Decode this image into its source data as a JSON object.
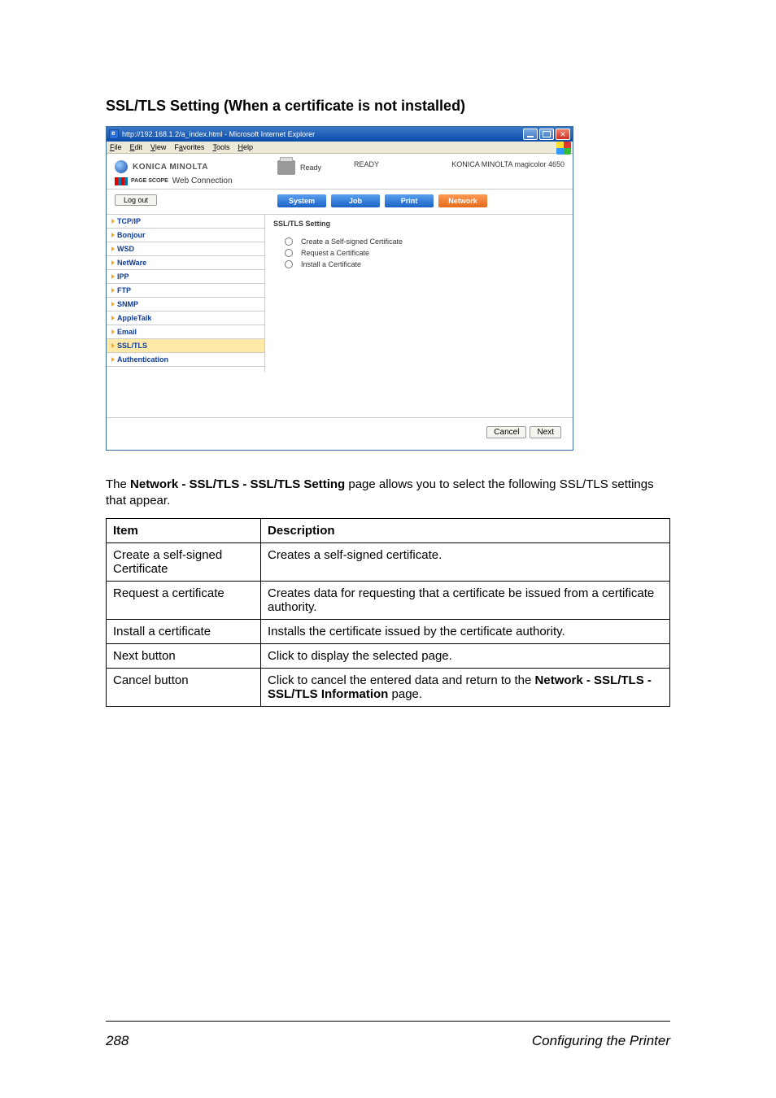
{
  "page": {
    "heading": "SSL/TLS Setting (When a certificate is not installed)",
    "number": "288",
    "footer_title": "Configuring the Printer"
  },
  "browser": {
    "title": "http://192.168.1.2/a_index.html - Microsoft Internet Explorer",
    "menu": {
      "file": "File",
      "edit": "Edit",
      "view": "View",
      "favorites": "Favorites",
      "tools": "Tools",
      "help": "Help"
    }
  },
  "app": {
    "brand": "KONICA MINOLTA",
    "pagescope": "PAGE SCOPE",
    "webconn": "Web Connection",
    "status_label": "Ready",
    "status_value": "READY",
    "device": "KONICA MINOLTA magicolor 4650",
    "logout": "Log out"
  },
  "tabs": {
    "system": "System",
    "job": "Job",
    "print": "Print",
    "network": "Network"
  },
  "sidebar": {
    "items": [
      {
        "label": "TCP/IP"
      },
      {
        "label": "Bonjour"
      },
      {
        "label": "WSD"
      },
      {
        "label": "NetWare"
      },
      {
        "label": "IPP"
      },
      {
        "label": "FTP"
      },
      {
        "label": "SNMP"
      },
      {
        "label": "AppleTalk"
      },
      {
        "label": "Email"
      },
      {
        "label": "SSL/TLS"
      },
      {
        "label": "Authentication"
      }
    ]
  },
  "content": {
    "section_title": "SSL/TLS Setting",
    "radios": [
      "Create a Self-signed Certificate",
      "Request a Certificate",
      "Install a Certificate"
    ],
    "cancel": "Cancel",
    "next": "Next"
  },
  "desc": {
    "line1_a": "The ",
    "line1_b": "Network - SSL/TLS - SSL/TLS Setting",
    "line1_c": " page allows you to select the following SSL/TLS settings that appear."
  },
  "table": {
    "headers": {
      "item": "Item",
      "desc": "Description"
    },
    "rows": [
      {
        "item": "Create a self-signed Certificate",
        "desc": "Creates a self-signed certificate."
      },
      {
        "item": "Request a certificate",
        "desc": "Creates data for requesting that a certificate be issued from a certificate authority."
      },
      {
        "item": "Install a certificate",
        "desc": "Installs the certificate issued by the certificate authority."
      },
      {
        "item": "Next button",
        "desc": "Click to display the selected page."
      },
      {
        "item": "Cancel button",
        "desc_a": "Click to cancel the entered data and return to the ",
        "desc_b": "Network - SSL/TLS - SSL/TLS Information",
        "desc_c": " page."
      }
    ]
  }
}
